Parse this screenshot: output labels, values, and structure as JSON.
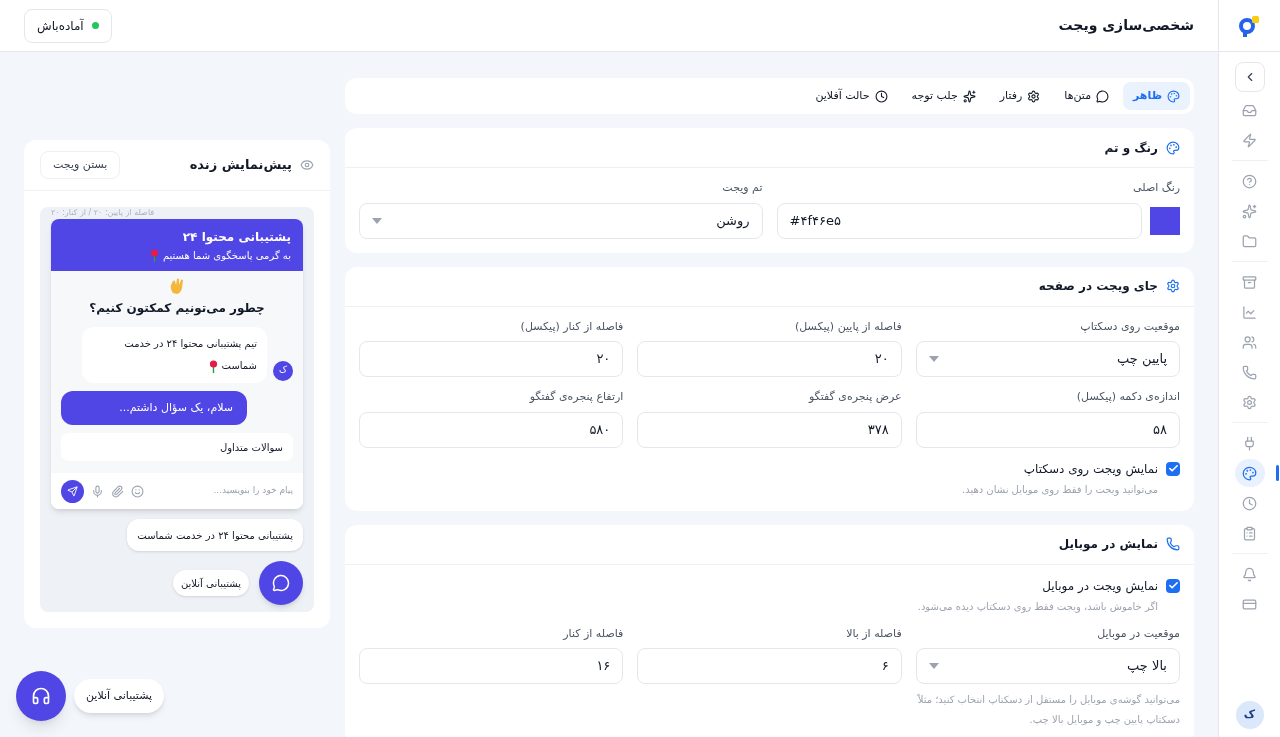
{
  "status": {
    "label": "آماده‌باش",
    "color": "#22c55e"
  },
  "page_title": "شخصی‌سازی ویجت",
  "tabs": [
    {
      "label": "ظاهر",
      "selected": true
    },
    {
      "label": "متن‌ها",
      "selected": false
    },
    {
      "label": "رفتار",
      "selected": false
    },
    {
      "label": "جلب توجه",
      "selected": false
    },
    {
      "label": "حالت آفلاین",
      "selected": false
    }
  ],
  "sections": [
    {
      "title": "رنگ و تم",
      "blocks": [
        {
          "kind": "fields",
          "fields": [
            {
              "kind": "color",
              "label": "رنگ اصلی",
              "value": "#۴f۴۶e۵",
              "color": "#4f46e5"
            },
            {
              "kind": "select",
              "label": "تم ویجت",
              "value": "روشن"
            }
          ]
        }
      ]
    },
    {
      "title": "جای ویجت در صفحه",
      "blocks": [
        {
          "kind": "fields",
          "fields": [
            {
              "kind": "select",
              "label": "موقعیت روی دسکتاپ",
              "value": "پایین چپ"
            },
            {
              "kind": "input",
              "label": "فاصله از پایین (پیکسل)",
              "value": "۲۰"
            },
            {
              "kind": "input",
              "label": "فاصله از کنار (پیکسل)",
              "value": "۲۰"
            }
          ]
        },
        {
          "kind": "fields",
          "fields": [
            {
              "kind": "input",
              "label": "اندازه‌ی دکمه (پیکسل)",
              "value": "۵۸"
            },
            {
              "kind": "input",
              "label": "عرض پنجره‌ی گفتگو",
              "value": "۳۷۸"
            },
            {
              "kind": "input",
              "label": "ارتفاع پنجره‌ی گفتگو",
              "value": "۵۸۰"
            }
          ]
        },
        {
          "kind": "checkbox",
          "label": "نمایش ویجت روی دسکتاپ",
          "hint": "می‌توانید ویجت را فقط روی موبایل نشان دهید.",
          "checked": true
        }
      ]
    },
    {
      "title": "نمایش در موبایل",
      "blocks": [
        {
          "kind": "checkbox",
          "label": "نمایش ویجت در موبایل",
          "hint": "اگر خاموش باشد، ویجت فقط روی دسکتاپ دیده می‌شود.",
          "checked": true
        },
        {
          "kind": "fields",
          "fields": [
            {
              "kind": "select",
              "label": "موقعیت در موبایل",
              "value": "بالا چپ"
            },
            {
              "kind": "input",
              "label": "فاصله از بالا",
              "value": "۶"
            },
            {
              "kind": "input",
              "label": "فاصله از کنار",
              "value": "۱۶"
            }
          ]
        },
        {
          "kind": "note",
          "text": "می‌توانید گوشه‌ی موبایل را مستقل از دسکتاپ انتخاب کنید؛ مثلاً دسکتاپ پایین چپ و موبایل بالا چپ."
        }
      ]
    }
  ],
  "preview": {
    "title": "پیش‌نمایش زنده",
    "close_button": "بستن ویجت",
    "position_note": "فاصله از پایین: ۲۰ / از کنار: ۲۰",
    "chat": {
      "title": "پشتیبانی محتوا ۲۴",
      "subtitle": "به گرمی پاسخگوی شما هستیم",
      "question": "چطور می‌تونیم کمکتون کنیم؟",
      "agent_message": "تیم پشتیبانی محتوا ۲۴ در خدمت شماست",
      "agent_avatar": "ک",
      "user_message": "سلام، یک سؤال داشتم...",
      "quick_reply": "سوالات متداول",
      "input_placeholder": "پیام خود را بنویسید..."
    },
    "teaser": "پشتیبانی محتوا ۲۴ در خدمت شماست",
    "launcher_label": "پشتیبانی آنلاین"
  },
  "floating_launcher": {
    "label": "پشتیبانی آنلاین"
  },
  "sidebar": {
    "groups": [
      [
        {
          "selected": false
        },
        {
          "selected": false
        }
      ],
      [
        {
          "selected": false
        },
        {
          "selected": false
        },
        {
          "selected": false
        }
      ],
      [
        {
          "selected": false
        },
        {
          "selected": false
        },
        {
          "selected": false
        },
        {
          "selected": false
        },
        {
          "selected": false
        }
      ],
      [
        {
          "selected": false
        },
        {
          "selected": true
        },
        {
          "selected": false
        },
        {
          "selected": false
        }
      ],
      [
        {
          "selected": false
        },
        {
          "selected": false
        }
      ]
    ],
    "avatar": "ک"
  }
}
